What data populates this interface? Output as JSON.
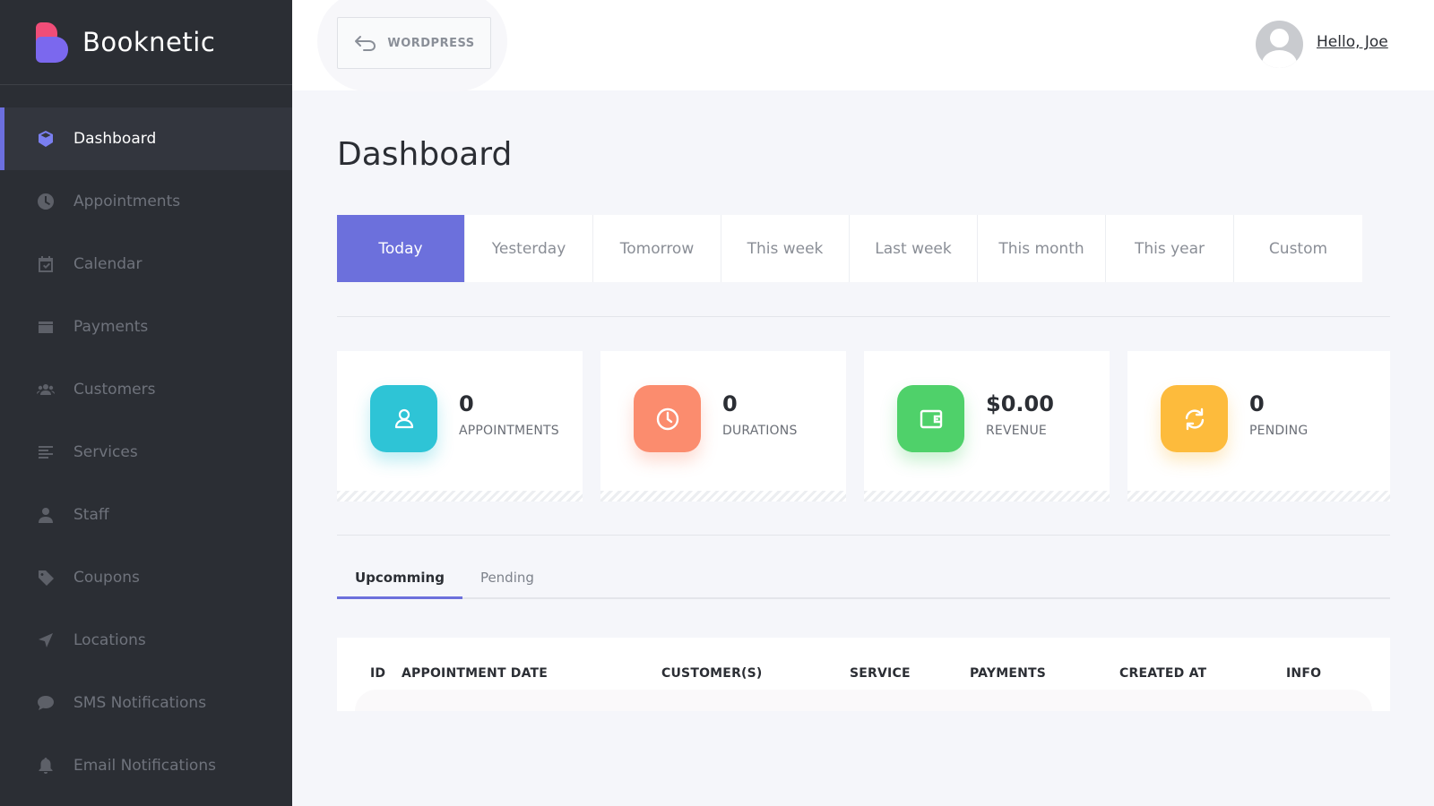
{
  "brand": {
    "name": "Booknetic"
  },
  "sidebar": {
    "items": [
      {
        "label": "Dashboard",
        "icon": "cube-icon",
        "active": true
      },
      {
        "label": "Appointments",
        "icon": "clock-icon"
      },
      {
        "label": "Calendar",
        "icon": "calendar-icon"
      },
      {
        "label": "Payments",
        "icon": "wallet-icon"
      },
      {
        "label": "Customers",
        "icon": "users-icon"
      },
      {
        "label": "Services",
        "icon": "list-icon"
      },
      {
        "label": "Staff",
        "icon": "user-icon"
      },
      {
        "label": "Coupons",
        "icon": "tag-icon"
      },
      {
        "label": "Locations",
        "icon": "location-arrow-icon"
      },
      {
        "label": "SMS Notifications",
        "icon": "chat-bubble-icon"
      },
      {
        "label": "Email Notifications",
        "icon": "bell-icon"
      }
    ]
  },
  "header": {
    "back_button": "WORDPRESS",
    "greeting": "Hello, Joe"
  },
  "main": {
    "title": "Dashboard",
    "filters": [
      "Today",
      "Yesterday",
      "Tomorrow",
      "This week",
      "Last week",
      "This month",
      "This year",
      "Custom"
    ],
    "active_filter": "Today",
    "stats": [
      {
        "value": "0",
        "label": "APPOINTMENTS",
        "color": "#2ec4d6",
        "icon": "person-icon"
      },
      {
        "value": "0",
        "label": "DURATIONS",
        "color": "#fb8c6e",
        "icon": "clock-icon"
      },
      {
        "value": "$0.00",
        "label": "REVENUE",
        "color": "#4fd16a",
        "icon": "wallet-icon"
      },
      {
        "value": "0",
        "label": "PENDING",
        "color": "#fdbb3c",
        "icon": "refresh-icon"
      }
    ],
    "tabs": [
      {
        "label": "Upcomming",
        "active": true
      },
      {
        "label": "Pending",
        "active": false
      }
    ],
    "table": {
      "columns": [
        "ID",
        "APPOINTMENT DATE",
        "CUSTOMER(S)",
        "SERVICE",
        "PAYMENTS",
        "CREATED AT",
        "INFO"
      ]
    }
  },
  "colors": {
    "sidebar_bg": "#2b2e34",
    "accent": "#6c70dc",
    "page_bg": "#f5f6fa"
  }
}
